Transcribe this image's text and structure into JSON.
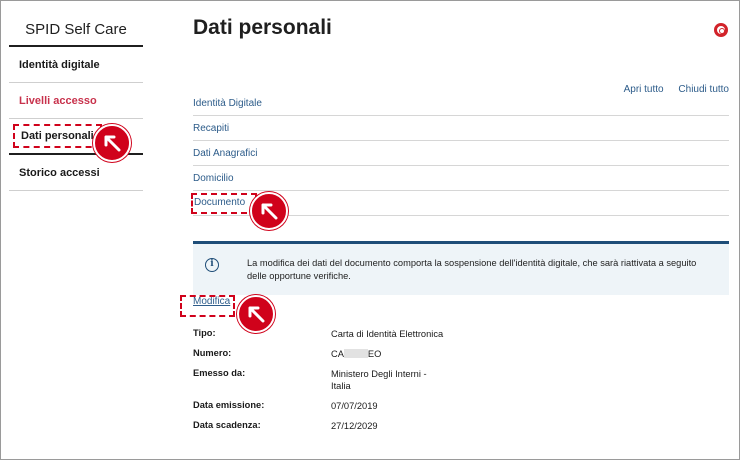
{
  "sidebar": {
    "title": "SPID Self Care",
    "items": [
      {
        "label": "Identità digitale"
      },
      {
        "label": "Livelli accesso"
      },
      {
        "label": "Dati personali"
      },
      {
        "label": "Storico accessi"
      }
    ]
  },
  "main": {
    "title": "Dati personali",
    "help_icon": "lifebuoy-icon",
    "expand_all": "Apri tutto",
    "collapse_all": "Chiudi tutto",
    "accordion": [
      {
        "label": "Identità Digitale"
      },
      {
        "label": "Recapiti"
      },
      {
        "label": "Dati Anagrafici"
      },
      {
        "label": "Domicilio"
      },
      {
        "label": "Documento"
      }
    ],
    "notice": {
      "icon": "info-icon",
      "text": "La modifica dei dati del documento comporta la sospensione dell'identità digitale, che sarà riattivata a seguito delle opportune verifiche."
    },
    "edit_link": "Modifica",
    "document": {
      "type_label": "Tipo:",
      "type_value": "Carta di Identità Elettronica",
      "number_label": "Numero:",
      "number_prefix": "CA",
      "number_suffix": "EO",
      "issuer_label": "Emesso da:",
      "issuer_value_line1": "Ministero Degli Interni -",
      "issuer_value_line2": "Italia",
      "issue_date_label": "Data emissione:",
      "issue_date_value": "07/07/2019",
      "expiry_date_label": "Data scadenza:",
      "expiry_date_value": "27/12/2029"
    }
  },
  "colors": {
    "accent_red": "#d0021b",
    "link_blue": "#2d5c8a",
    "notice_bg": "#eef4f8",
    "notice_border": "#1e4d78",
    "warning_text": "#c8324c"
  }
}
